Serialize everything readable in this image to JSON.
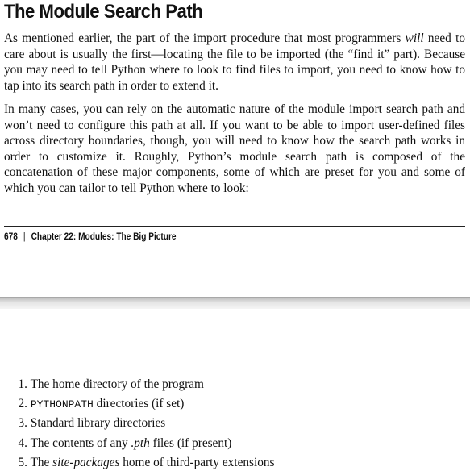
{
  "heading": "The Module Search Path",
  "para1": {
    "before_will": "As mentioned earlier, the part of the import procedure that most programmers ",
    "will": "will",
    "after_will": " need to care about is usually the first—locating the file to be imported (the “find it” part). Because you may need to tell Python where to look to find files to import, you need to know how to tap into its search path in order to extend it."
  },
  "para2": "In many cases, you can rely on the automatic nature of the module import search path and won’t need to configure this path at all. If you want to be able to import user-defined files across directory boundaries, though, you will need to know how the search path works in order to customize it. Roughly, Python’s module search path is composed of the concatenation of these major components, some of which are preset for you and some of which you can tailor to tell Python where to look:",
  "footer": {
    "page_number": "678",
    "separator": "|",
    "chapter": "Chapter 22:  Modules: The Big Picture"
  },
  "list": {
    "item1": {
      "num": "1.",
      "text": "The home directory of the program"
    },
    "item2": {
      "num": "2.",
      "code": "PYTHONPATH",
      "text": " directories (if set)"
    },
    "item3": {
      "num": "3.",
      "text": "Standard library directories"
    },
    "item4": {
      "num": "4.",
      "before": "The contents of any ",
      "em": ".pth",
      "after": " files (if present)"
    },
    "item5": {
      "num": "5.",
      "before": "The ",
      "em": "site-packages",
      "after": " home of third-party extensions"
    }
  }
}
